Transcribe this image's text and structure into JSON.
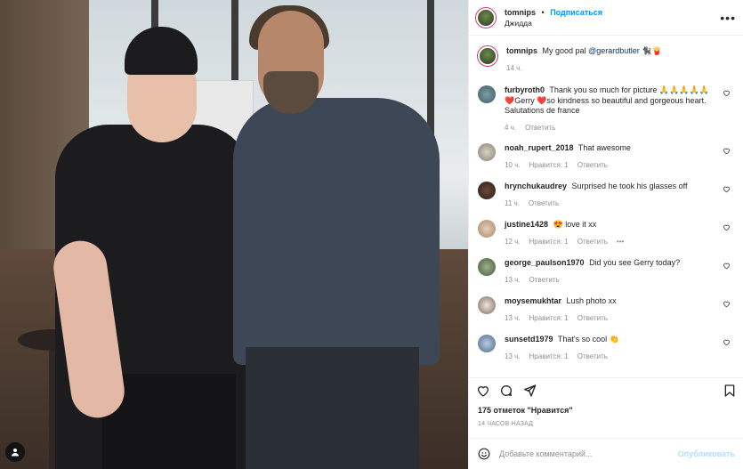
{
  "header": {
    "username": "tomnips",
    "separator": "•",
    "follow_label": "Подписаться",
    "location": "Джидда",
    "more_icon": "more-horizontal-icon"
  },
  "caption": {
    "username": "tomnips",
    "text": "My good pal",
    "mention": "@gerardbutler",
    "time": "14 ч."
  },
  "comments": [
    {
      "username": "furbyroth0",
      "text": "Thank you so much for picture 🙏🙏🙏🙏🙏 ❤️Gerry ❤️so kindness so beautiful and gorgeous heart. Salutations de france",
      "time": "4 ч.",
      "likes": "",
      "reply": "Ответить"
    },
    {
      "username": "noah_rupert_2018",
      "text": "That awesome",
      "time": "10 ч.",
      "likes": "Нравится: 1",
      "reply": "Ответить"
    },
    {
      "username": "hrynchukaudrey",
      "text": "Surprised he took his glasses off",
      "time": "11 ч.",
      "likes": "",
      "reply": "Ответить"
    },
    {
      "username": "justine1428",
      "text": "😍 love it xx",
      "time": "12 ч.",
      "likes": "Нравится: 1",
      "reply": "Ответить"
    },
    {
      "username": "george_paulson1970",
      "text": "Did you see Gerry today?",
      "time": "13 ч.",
      "likes": "",
      "reply": "Ответить"
    },
    {
      "username": "moysemukhtar",
      "text": "Lush photo xx",
      "time": "13 ч.",
      "likes": "Нравится: 1",
      "reply": "Ответить"
    },
    {
      "username": "sunsetd1979",
      "text": "That's so cool 👏",
      "time": "13 ч.",
      "likes": "Нравится: 1",
      "reply": "Ответить"
    }
  ],
  "stats": {
    "likes": "175 отметок \"Нравится\"",
    "ago": "14 ЧАСОВ НАЗАД"
  },
  "composer": {
    "placeholder": "Добавьте комментарий...",
    "publish": "Опубликовать"
  },
  "colors": {
    "accent": "#0095f6",
    "muted": "#8e8e8e",
    "publish_disabled": "#b2dffc"
  }
}
